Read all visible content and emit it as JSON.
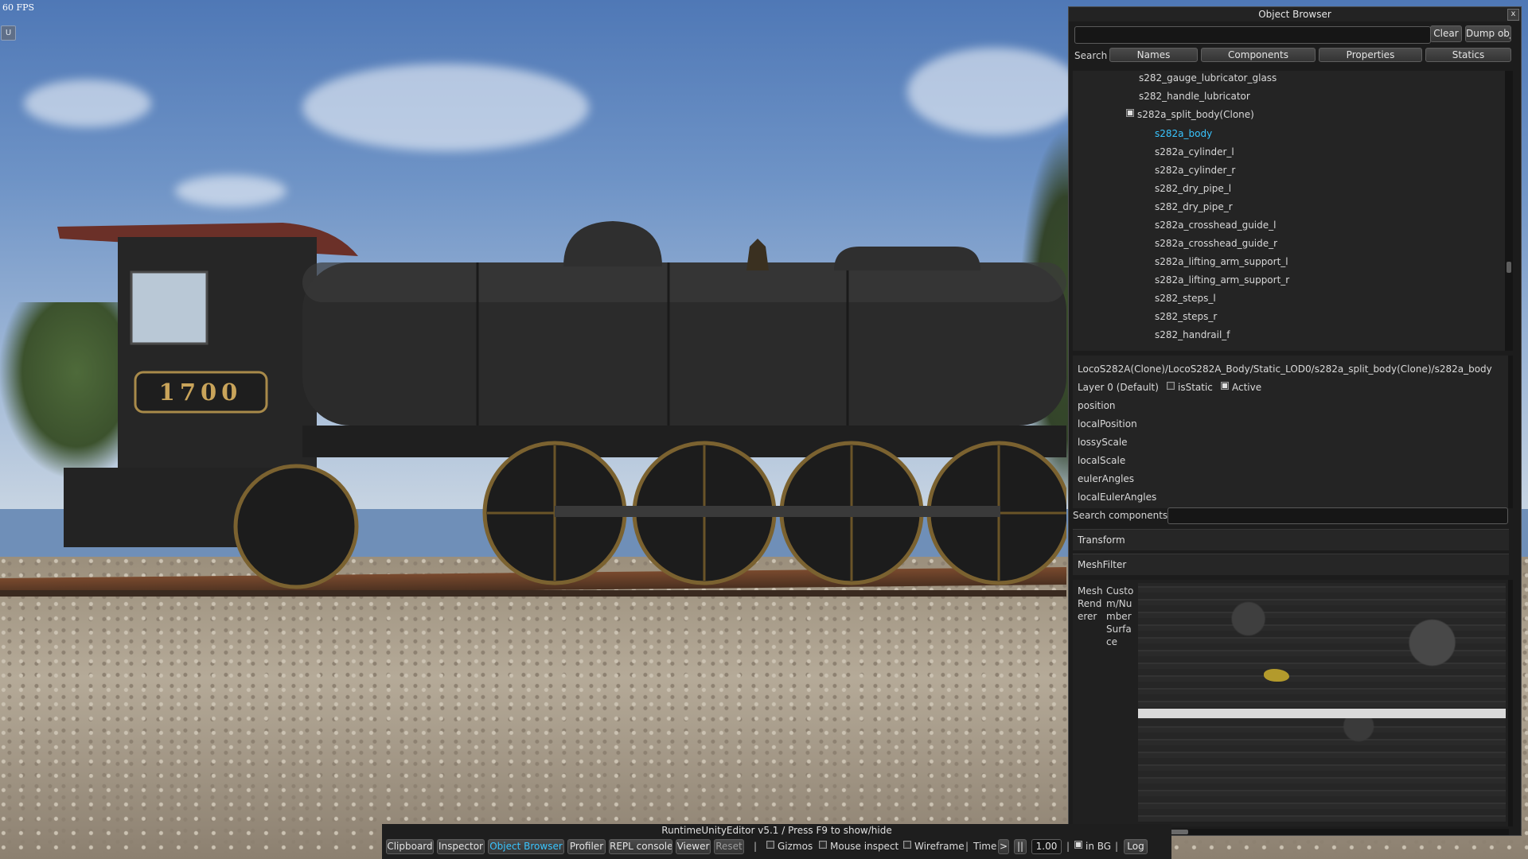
{
  "overlay": {
    "fps": "60 FPS",
    "mini_button": "U"
  },
  "loco_number": "1700",
  "object_browser": {
    "title": "Object Browser",
    "close": "x",
    "search_value": "",
    "clear_label": "Clear",
    "dump_label": "Dump obj",
    "search_label": "Search",
    "filters": [
      "Names",
      "Components",
      "Properties",
      "Statics"
    ],
    "tree": [
      {
        "label": "s282_gauge_lubricator_glass",
        "depth": 0,
        "selected": false
      },
      {
        "label": "s282_handle_lubricator",
        "depth": 0,
        "selected": false
      },
      {
        "label": "s282a_split_body(Clone)",
        "depth": 0,
        "selected": false,
        "expandable": true
      },
      {
        "label": "s282a_body",
        "depth": 1,
        "selected": true
      },
      {
        "label": "s282a_cylinder_l",
        "depth": 1,
        "selected": false
      },
      {
        "label": "s282a_cylinder_r",
        "depth": 1,
        "selected": false
      },
      {
        "label": "s282_dry_pipe_l",
        "depth": 1,
        "selected": false
      },
      {
        "label": "s282_dry_pipe_r",
        "depth": 1,
        "selected": false
      },
      {
        "label": "s282a_crosshead_guide_l",
        "depth": 1,
        "selected": false
      },
      {
        "label": "s282a_crosshead_guide_r",
        "depth": 1,
        "selected": false
      },
      {
        "label": "s282a_lifting_arm_support_l",
        "depth": 1,
        "selected": false
      },
      {
        "label": "s282a_lifting_arm_support_r",
        "depth": 1,
        "selected": false
      },
      {
        "label": "s282_steps_l",
        "depth": 1,
        "selected": false
      },
      {
        "label": "s282_steps_r",
        "depth": 1,
        "selected": false
      },
      {
        "label": "s282_handrail_f",
        "depth": 1,
        "selected": false
      }
    ],
    "details": {
      "path": "LocoS282A(Clone)/LocoS282A_Body/Static_LOD0/s282a_split_body(Clone)/s282a_body",
      "layer": "Layer 0 (Default)",
      "is_static_label": "isStatic",
      "active_label": "Active",
      "properties": [
        "position",
        "localPosition",
        "lossyScale",
        "localScale",
        "eulerAngles",
        "localEulerAngles"
      ]
    },
    "search_components_label": "Search components",
    "components": [
      "Transform",
      "MeshFilter"
    ],
    "renderer": {
      "name_lines": [
        "Mesh",
        "Rend",
        "erer"
      ],
      "material_lines": [
        "Custo",
        "m/Nu",
        "mber",
        "Surfa",
        "ce"
      ]
    }
  },
  "bottom_bar": {
    "title": "RuntimeUnityEditor v5.1 / Press F9 to show/hide",
    "buttons": [
      "Clipboard",
      "Inspector",
      "Object Browser",
      "Profiler",
      "REPL console",
      "Viewer",
      "Reset"
    ],
    "active_button": "Object Browser",
    "toggles": [
      "Gizmos",
      "Mouse inspect",
      "Wireframe"
    ],
    "time_label": "Time",
    "time_step": ">",
    "pause": "||",
    "time_value": "1.00",
    "in_bg_label": "in BG",
    "log_label": "Log",
    "separator": "|"
  }
}
